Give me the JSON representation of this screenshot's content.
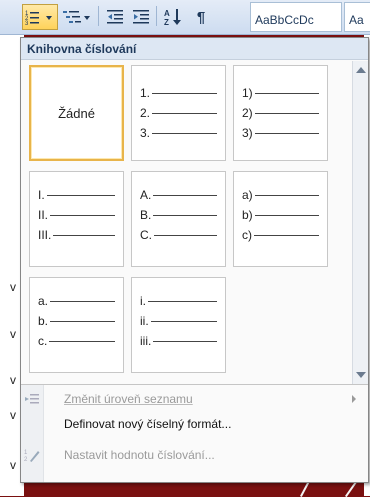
{
  "ribbon": {
    "style_preview": "AaBbCcDc",
    "style_preview_2": "Aa",
    "pilcrow": "¶",
    "sort_icon": "sort-az-icon"
  },
  "document_fragments": [
    "v",
    "v",
    "v",
    "v",
    "v"
  ],
  "menu": {
    "title": "Knihovna číslování",
    "tiles": [
      {
        "type": "none",
        "label": "Žádné",
        "selected": true
      },
      {
        "markers": [
          "1.",
          "2.",
          "3."
        ]
      },
      {
        "markers": [
          "1)",
          "2)",
          "3)"
        ]
      },
      {
        "markers": [
          "I.",
          "II.",
          "III."
        ]
      },
      {
        "markers": [
          "A.",
          "B.",
          "C."
        ]
      },
      {
        "markers": [
          "a)",
          "b)",
          "c)"
        ]
      },
      {
        "markers": [
          "a.",
          "b.",
          "c."
        ]
      },
      {
        "markers": [
          "i.",
          "ii.",
          "iii."
        ]
      }
    ],
    "items": [
      {
        "label": "Změnit úroveň seznamu",
        "disabled": true,
        "icon": "list-level-icon",
        "submenu": true
      },
      {
        "label": "Definovat nový číselný formát...",
        "disabled": false
      },
      {
        "label": "Nastavit hodnotu číslování...",
        "disabled": true,
        "icon": "set-value-icon"
      }
    ]
  }
}
